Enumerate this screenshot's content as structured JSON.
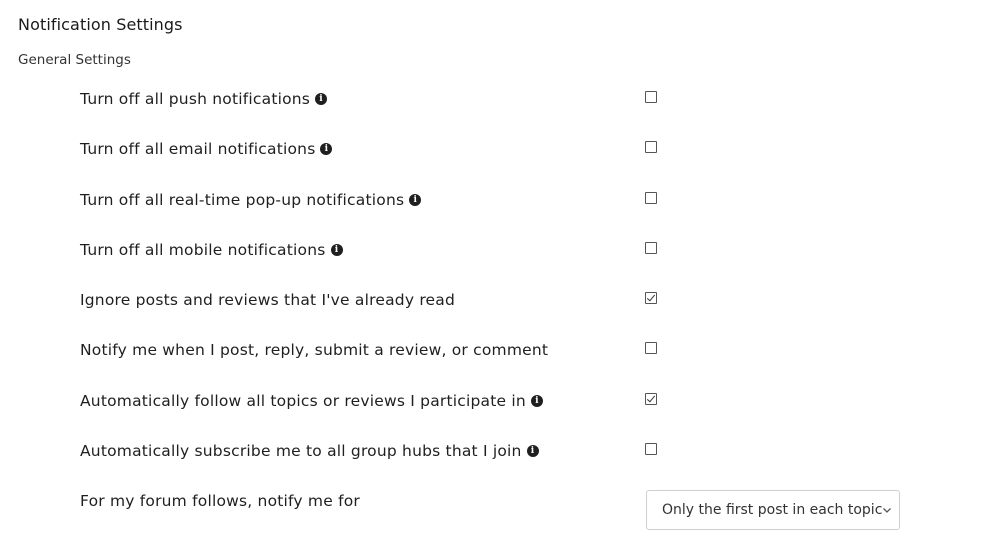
{
  "page": {
    "title": "Notification Settings",
    "section_title": "General Settings"
  },
  "settings": [
    {
      "label": "Turn off all push notifications",
      "info_icon": true,
      "checked": false
    },
    {
      "label": "Turn off all email notifications",
      "info_icon": true,
      "checked": false
    },
    {
      "label": "Turn off all real-time pop-up notifications",
      "info_icon": true,
      "checked": false
    },
    {
      "label": "Turn off all mobile notifications",
      "info_icon": true,
      "checked": false
    },
    {
      "label": "Ignore posts and reviews that I've already read",
      "info_icon": false,
      "checked": true
    },
    {
      "label": "Notify me when I post, reply, submit a review, or comment",
      "info_icon": false,
      "checked": false
    },
    {
      "label": "Automatically follow all topics or reviews I participate in",
      "info_icon": true,
      "checked": true
    },
    {
      "label": "Automatically subscribe me to all group hubs that I join",
      "info_icon": true,
      "checked": false
    }
  ],
  "forum_follows": {
    "label": "For my forum follows, notify me for",
    "selected_option": "Only the first post in each topic"
  },
  "icons": {
    "info": "info-icon",
    "dropdown": "chevron-down-icon"
  }
}
